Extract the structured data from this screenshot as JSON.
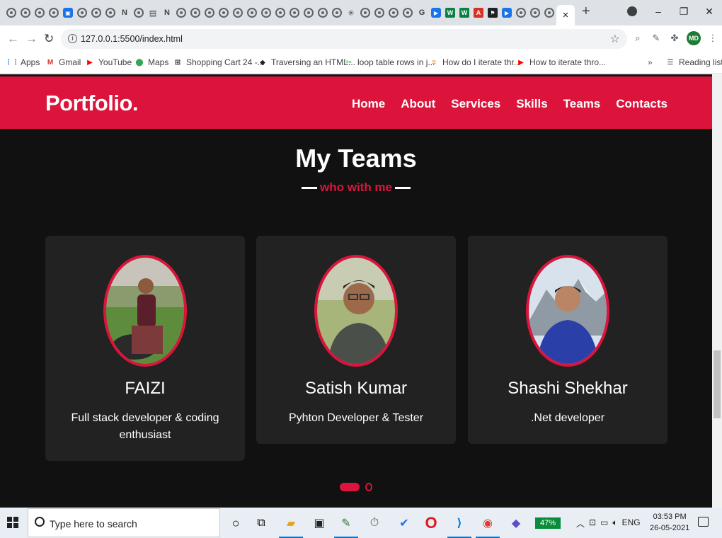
{
  "browser": {
    "tabs": [
      {
        "icon": "globe-icon"
      },
      {
        "icon": "globe-icon"
      },
      {
        "icon": "globe-icon"
      },
      {
        "icon": "globe-icon"
      },
      {
        "icon": "zoom-icon",
        "letter": "▣"
      },
      {
        "icon": "globe-icon"
      },
      {
        "icon": "globe-icon"
      },
      {
        "icon": "globe-icon"
      },
      {
        "icon": "notion-icon",
        "letter": "N"
      },
      {
        "icon": "globe-icon"
      },
      {
        "icon": "wifi-icon",
        "letter": "▤"
      },
      {
        "icon": "notion-icon",
        "letter": "N"
      },
      {
        "icon": "globe-icon"
      },
      {
        "icon": "globe-icon"
      },
      {
        "icon": "globe-icon"
      },
      {
        "icon": "globe-icon"
      },
      {
        "icon": "globe-icon"
      },
      {
        "icon": "globe-icon"
      },
      {
        "icon": "globe-icon"
      },
      {
        "icon": "globe-icon"
      },
      {
        "icon": "globe-icon"
      },
      {
        "icon": "globe-icon"
      },
      {
        "icon": "globe-icon"
      },
      {
        "icon": "globe-icon"
      },
      {
        "icon": "spark-icon",
        "letter": "✳"
      },
      {
        "icon": "globe-icon"
      },
      {
        "icon": "globe-icon"
      },
      {
        "icon": "globe-icon"
      },
      {
        "icon": "globe-icon"
      },
      {
        "icon": "google-icon",
        "letter": "G"
      },
      {
        "icon": "bookmark-blue-icon",
        "letter": "▶"
      },
      {
        "icon": "wiki-icon",
        "letter": "W"
      },
      {
        "icon": "wiki-icon",
        "letter": "W"
      },
      {
        "icon": "pdf-icon",
        "letter": "A"
      },
      {
        "icon": "flag-icon",
        "letter": "⚑"
      },
      {
        "icon": "bookmark-blue-icon",
        "letter": "▶"
      },
      {
        "icon": "globe-icon"
      },
      {
        "icon": "globe-icon"
      },
      {
        "icon": "globe-icon"
      }
    ],
    "active_tab_close": "×",
    "new_tab": "+",
    "window_controls": [
      "–",
      "❐",
      "✕"
    ],
    "url_info": "i",
    "url": "127.0.0.1:5500/index.html",
    "bookmarks": [
      {
        "label": "Apps",
        "icon": "apps-grid-icon",
        "glyph": "⋮⋮",
        "color": "#4285f4"
      },
      {
        "label": "Gmail",
        "icon": "gmail-icon",
        "glyph": "M",
        "color": "#d93025"
      },
      {
        "label": "YouTube",
        "icon": "youtube-icon",
        "glyph": "▶",
        "color": "#ff0000"
      },
      {
        "label": "Maps",
        "icon": "maps-pin-icon",
        "glyph": "⬤",
        "color": "#34a853"
      },
      {
        "label": "Shopping Cart 24 -...",
        "icon": "cart-icon",
        "glyph": "⊞",
        "color": "#202124"
      },
      {
        "label": "Traversing an HTML...",
        "icon": "page-icon",
        "glyph": "◆",
        "color": "#202124"
      },
      {
        "label": "loop table rows in j...",
        "icon": "tools-icon",
        "glyph": "✂",
        "color": "#34a853"
      },
      {
        "label": "How do I iterate thr...",
        "icon": "stackoverflow-icon",
        "glyph": "≡",
        "color": "#f48024"
      },
      {
        "label": "How to iterate thro...",
        "icon": "youtube-icon",
        "glyph": "▶",
        "color": "#ff0000"
      }
    ],
    "overflow": "»",
    "reading_list": "Reading list",
    "profile_initials": "MD"
  },
  "page": {
    "logo": "Portfolio.",
    "menu": [
      "Home",
      "About",
      "Services",
      "Skills",
      "Teams",
      "Contacts"
    ],
    "section_title": "My Teams",
    "section_subtitle": "who with me",
    "members": [
      {
        "name": "FAIZI",
        "role": "Full stack developer & coding enthusiast"
      },
      {
        "name": "Satish Kumar",
        "role": "Pyhton Developer & Tester"
      },
      {
        "name": "Shashi Shekhar",
        "role": ".Net developer"
      }
    ],
    "accent_color": "#dc143c",
    "carousel_pages": 2,
    "carousel_active": 1
  },
  "taskbar": {
    "search_placeholder": "Type here to search",
    "battery": "47%",
    "language": "ENG",
    "time": "03:53 PM",
    "date": "26-05-2021"
  }
}
